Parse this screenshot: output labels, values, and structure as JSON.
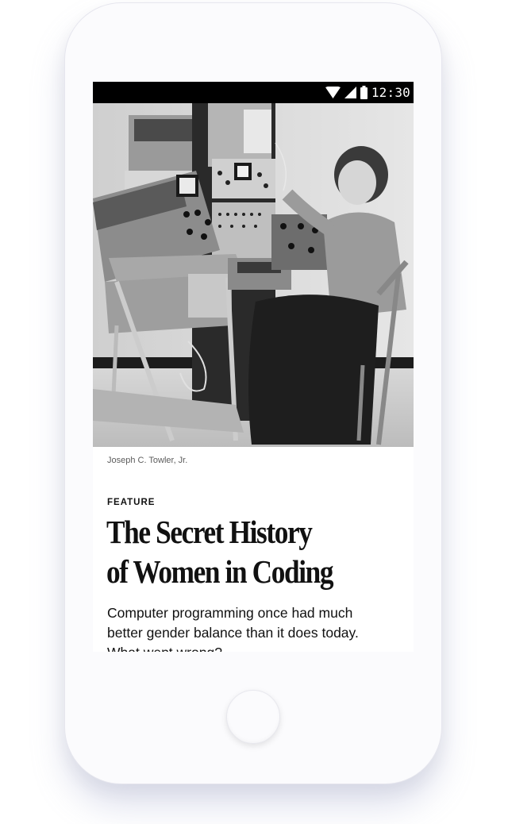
{
  "status_bar": {
    "time": "12:30",
    "icons": [
      "wifi-icon",
      "cellular-signal-icon",
      "battery-icon"
    ]
  },
  "article": {
    "photo": {
      "semantic": "black-and-white archival photo of a woman operating early computer equipment"
    },
    "photo_credit": "Joseph C. Towler, Jr.",
    "kicker": "FEATURE",
    "headline_lines": [
      "The Secret History",
      "of Women in Coding"
    ],
    "dek_lines": [
      "Computer programming once had much",
      "better gender balance than it does today.",
      "What went wrong?"
    ]
  },
  "device": {
    "home_button": "home-button"
  },
  "colors": {
    "status_bar": "#000000",
    "text": "#111111",
    "credit_text": "#5c5c5c",
    "phone_body": "#fbfbfd",
    "shadow_tint": "#969bc8"
  }
}
